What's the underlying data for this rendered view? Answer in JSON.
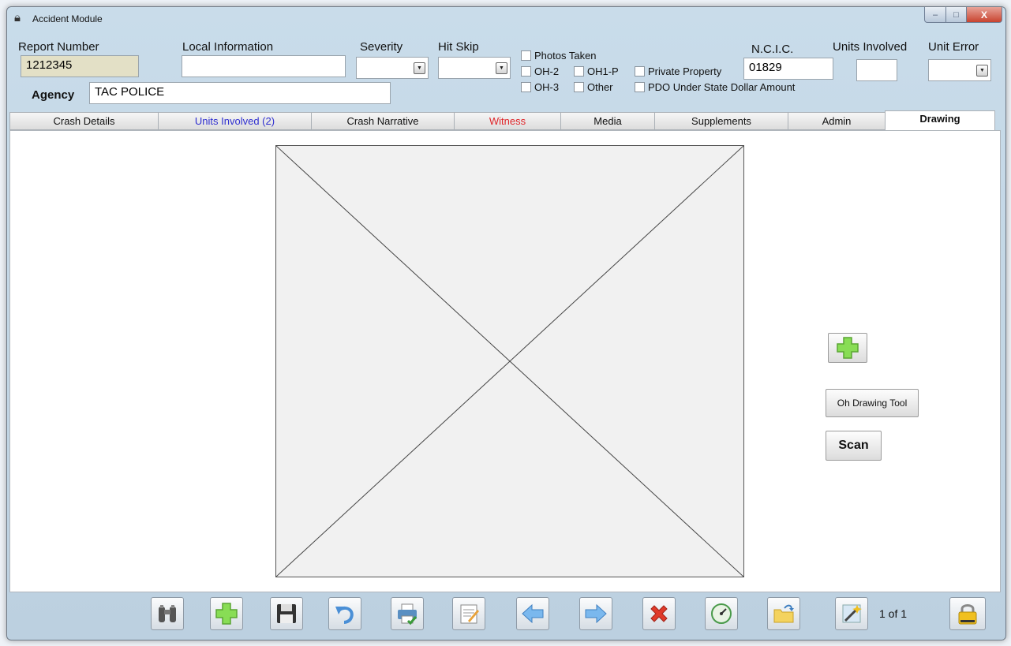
{
  "window": {
    "title": "Accident Module",
    "controls": {
      "minimize": "–",
      "maximize": "□",
      "close": "X"
    }
  },
  "header": {
    "report_number": {
      "label": "Report Number",
      "value": "1212345"
    },
    "local_information": {
      "label": "Local Information",
      "value": ""
    },
    "severity": {
      "label": "Severity",
      "value": ""
    },
    "hit_skip": {
      "label": "Hit Skip",
      "value": ""
    },
    "checkboxes": {
      "photos_taken": "Photos Taken",
      "oh2": "OH-2",
      "oh1p": "OH1-P",
      "private_property": "Private Property",
      "oh3": "OH-3",
      "other": "Other",
      "pdo": "PDO Under State Dollar Amount"
    },
    "ncic": {
      "label": "N.C.I.C.",
      "value": "01829"
    },
    "units_involved": {
      "label": "Units Involved",
      "value": ""
    },
    "unit_error": {
      "label": "Unit Error",
      "value": ""
    },
    "agency": {
      "label": "Agency",
      "value": "TAC POLICE"
    }
  },
  "tabs": [
    {
      "label": "Crash Details"
    },
    {
      "label": "Units Involved (2)"
    },
    {
      "label": "Crash Narrative"
    },
    {
      "label": "Witness"
    },
    {
      "label": "Media"
    },
    {
      "label": "Supplements"
    },
    {
      "label": "Admin"
    },
    {
      "label": "Drawing"
    }
  ],
  "drawing": {
    "add_icon": "plus-icon",
    "drawing_tool_label": "Oh Drawing Tool",
    "scan_label": "Scan"
  },
  "toolbar": {
    "icons": [
      "binoculars-icon",
      "add-icon",
      "save-icon",
      "undo-icon",
      "print-icon",
      "notepad-icon",
      "back-arrow-icon",
      "forward-arrow-icon",
      "delete-icon",
      "gauge-icon",
      "folder-icon",
      "wand-icon",
      "lock-icon"
    ],
    "pager": "1 of 1"
  },
  "colors": {
    "window_bg": "#c3d6e6",
    "report_field_bg": "#e3e0c6",
    "tab_units_text": "#2f2fd0",
    "tab_witness_text": "#e0262a",
    "plus_green": "#7ed957"
  }
}
